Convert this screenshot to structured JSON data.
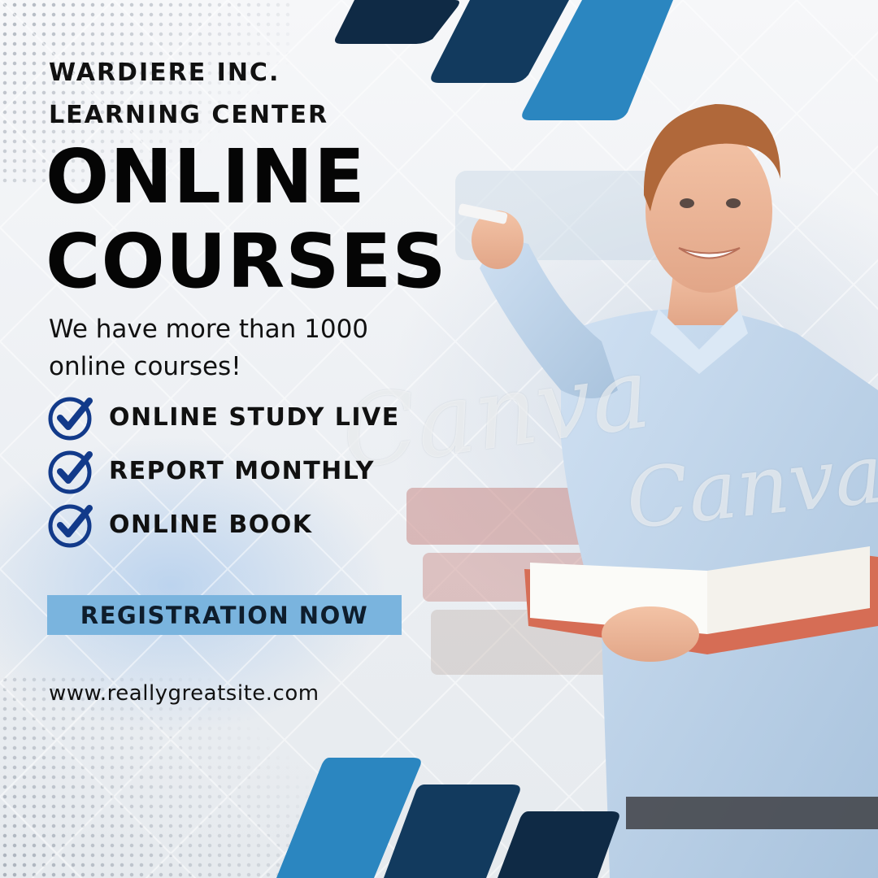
{
  "brand": {
    "name_line1": "WARDIERE INC.",
    "name_line2": "LEARNING CENTER"
  },
  "headline": {
    "line1": "ONLINE",
    "line2": "COURSES"
  },
  "tagline": {
    "line1": "We have more than 1000",
    "line2": "online courses!"
  },
  "features": [
    {
      "label": "ONLINE STUDY LIVE",
      "icon": "check-circle-icon"
    },
    {
      "label": "REPORT MONTHLY",
      "icon": "check-circle-icon"
    },
    {
      "label": "ONLINE BOOK",
      "icon": "check-circle-icon"
    }
  ],
  "cta": {
    "label": "REGISTRATION NOW"
  },
  "website": "www.reallygreatsite.com",
  "watermark": "Canva",
  "colors": {
    "navy": "#0f2a45",
    "mid_navy": "#123a5e",
    "blue": "#2b86c0",
    "light_blue": "#7ab4de",
    "text": "#111111"
  }
}
